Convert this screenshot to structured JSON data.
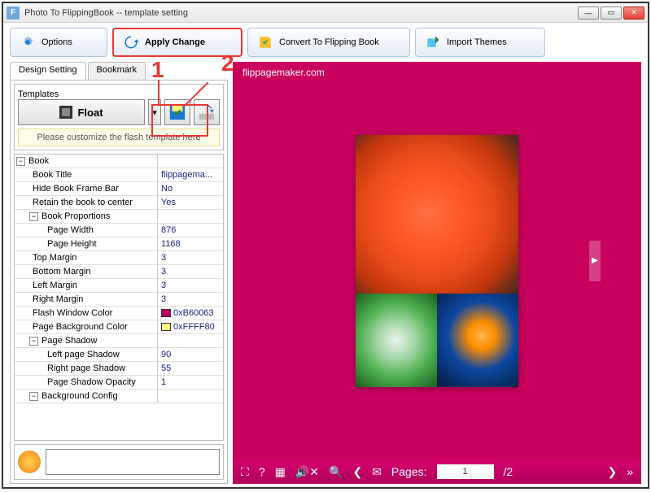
{
  "window": {
    "title": "Photo To FlippingBook -- template setting"
  },
  "toolbar": {
    "options": "Options",
    "apply": "Apply Change",
    "convert": "Convert To Flipping Book",
    "import": "Import Themes"
  },
  "tabs": {
    "design": "Design Setting",
    "bookmark": "Bookmark"
  },
  "templates": {
    "legend": "Templates",
    "float": "Float",
    "hint": "Please customize the flash template here"
  },
  "props": {
    "book": "Book",
    "book_title_k": "Book Title",
    "book_title_v": "flippagema...",
    "hide_frame_k": "Hide Book Frame Bar",
    "hide_frame_v": "No",
    "retain_k": "Retain the book to center",
    "retain_v": "Yes",
    "proportions": "Book Proportions",
    "pw_k": "Page Width",
    "pw_v": "876",
    "ph_k": "Page Height",
    "ph_v": "1168",
    "tm_k": "Top Margin",
    "tm_v": "3",
    "bm_k": "Bottom Margin",
    "bm_v": "3",
    "lm_k": "Left Margin",
    "lm_v": "3",
    "rm_k": "Right Margin",
    "rm_v": "3",
    "fwc_k": "Flash Window Color",
    "fwc_v": "0xB60063",
    "fwc_c": "#b60063",
    "pbc_k": "Page Background Color",
    "pbc_v": "0xFFFF80",
    "pbc_c": "#ffff80",
    "pshadow": "Page Shadow",
    "ls_k": "Left page Shadow",
    "ls_v": "90",
    "rs_k": "Right page Shadow",
    "rs_v": "55",
    "so_k": "Page Shadow Opacity",
    "so_v": "1",
    "bg": "Background Config"
  },
  "preview": {
    "brand": "flippagemaker.com",
    "pages_label": "Pages:",
    "page_current": "1",
    "page_total": "/2"
  },
  "annot": {
    "n1": "1",
    "n2": "2"
  }
}
